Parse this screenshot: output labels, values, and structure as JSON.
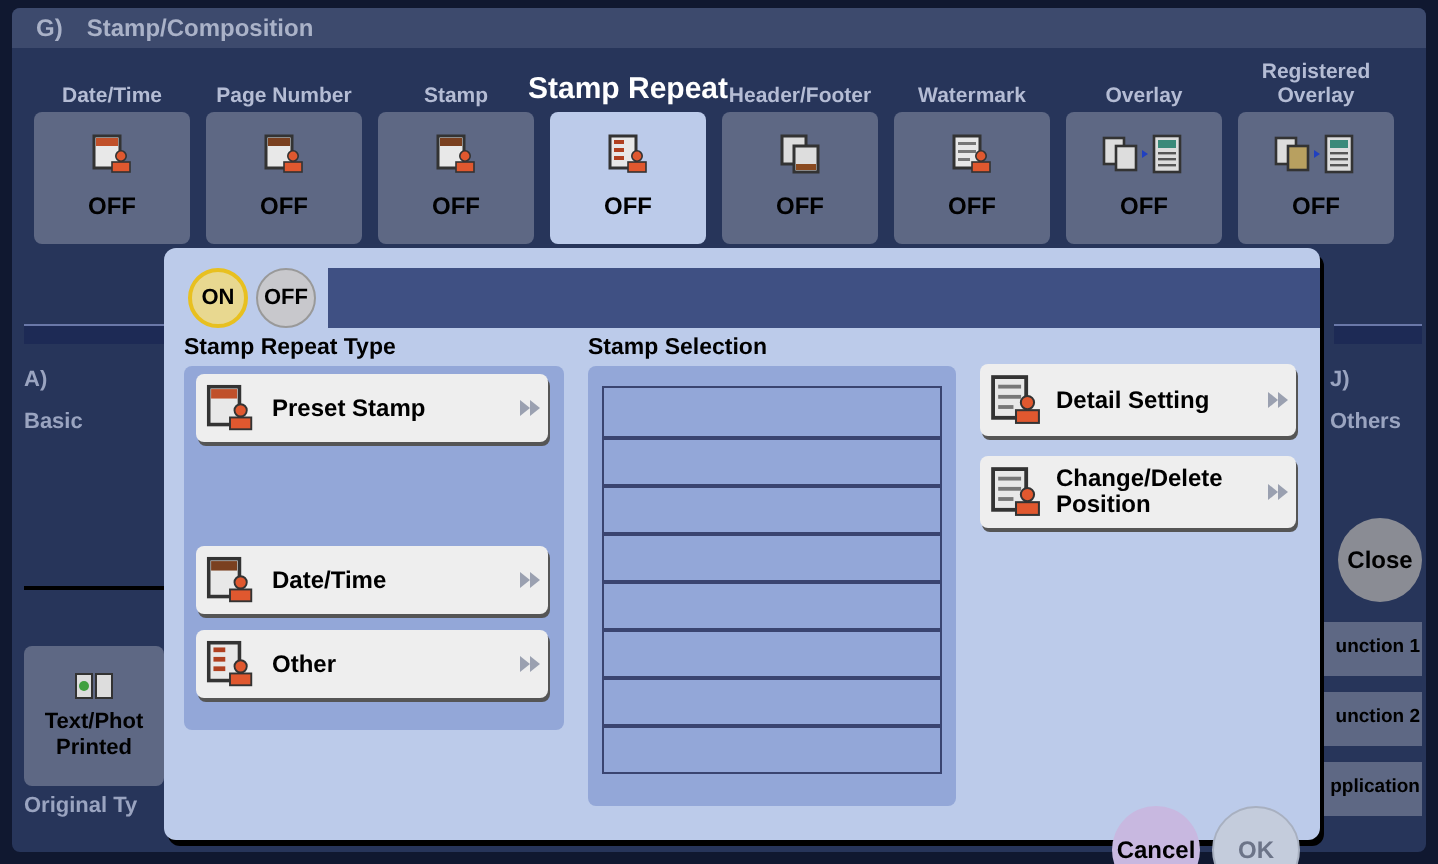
{
  "header": {
    "index": "G)",
    "title": "Stamp/Composition"
  },
  "tabs": [
    {
      "label": "Date/Time",
      "status": "OFF",
      "selected": false
    },
    {
      "label": "Page Number",
      "status": "OFF",
      "selected": false
    },
    {
      "label": "Stamp",
      "status": "OFF",
      "selected": false
    },
    {
      "label": "Stamp Repeat",
      "status": "OFF",
      "selected": true
    },
    {
      "label": "Header/Footer",
      "status": "OFF",
      "selected": false
    },
    {
      "label": "Watermark",
      "status": "OFF",
      "selected": false
    },
    {
      "label": "Overlay",
      "status": "OFF",
      "selected": false
    },
    {
      "label": "Registered Overlay",
      "status": "OFF",
      "selected": false
    }
  ],
  "left_panel": {
    "index": "A)",
    "label": "Basic",
    "tile": {
      "label": "Text/Phot",
      "value": "Printed"
    },
    "caption": "Original Ty"
  },
  "right_panel": {
    "index": "J)",
    "label": "Others",
    "close": "Close",
    "buttons": [
      "unction 1",
      "unction 2",
      "pplication"
    ]
  },
  "dialog": {
    "toggle": [
      {
        "label": "ON",
        "selected": true
      },
      {
        "label": "OFF",
        "selected": false
      }
    ],
    "type_panel": {
      "title": "Stamp Repeat Type",
      "items": [
        {
          "label": "Preset Stamp"
        },
        {
          "label": "Date/Time"
        },
        {
          "label": "Other"
        }
      ]
    },
    "selection": {
      "title": "Stamp Selection"
    },
    "actions": [
      {
        "label": "Detail Setting"
      },
      {
        "label": "Change/Delete Position"
      }
    ],
    "cancel": "Cancel",
    "ok": {
      "label": "OK",
      "disabled": true
    }
  }
}
